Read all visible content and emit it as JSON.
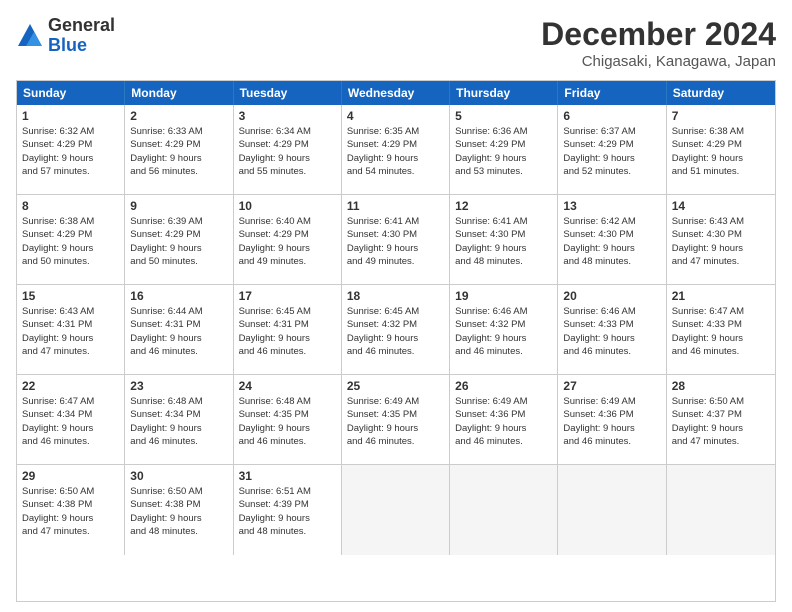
{
  "header": {
    "logo_general": "General",
    "logo_blue": "Blue",
    "month": "December 2024",
    "location": "Chigasaki, Kanagawa, Japan"
  },
  "weekdays": [
    "Sunday",
    "Monday",
    "Tuesday",
    "Wednesday",
    "Thursday",
    "Friday",
    "Saturday"
  ],
  "weeks": [
    [
      {
        "day": "1",
        "lines": [
          "Sunrise: 6:32 AM",
          "Sunset: 4:29 PM",
          "Daylight: 9 hours",
          "and 57 minutes."
        ]
      },
      {
        "day": "2",
        "lines": [
          "Sunrise: 6:33 AM",
          "Sunset: 4:29 PM",
          "Daylight: 9 hours",
          "and 56 minutes."
        ]
      },
      {
        "day": "3",
        "lines": [
          "Sunrise: 6:34 AM",
          "Sunset: 4:29 PM",
          "Daylight: 9 hours",
          "and 55 minutes."
        ]
      },
      {
        "day": "4",
        "lines": [
          "Sunrise: 6:35 AM",
          "Sunset: 4:29 PM",
          "Daylight: 9 hours",
          "and 54 minutes."
        ]
      },
      {
        "day": "5",
        "lines": [
          "Sunrise: 6:36 AM",
          "Sunset: 4:29 PM",
          "Daylight: 9 hours",
          "and 53 minutes."
        ]
      },
      {
        "day": "6",
        "lines": [
          "Sunrise: 6:37 AM",
          "Sunset: 4:29 PM",
          "Daylight: 9 hours",
          "and 52 minutes."
        ]
      },
      {
        "day": "7",
        "lines": [
          "Sunrise: 6:38 AM",
          "Sunset: 4:29 PM",
          "Daylight: 9 hours",
          "and 51 minutes."
        ]
      }
    ],
    [
      {
        "day": "8",
        "lines": [
          "Sunrise: 6:38 AM",
          "Sunset: 4:29 PM",
          "Daylight: 9 hours",
          "and 50 minutes."
        ]
      },
      {
        "day": "9",
        "lines": [
          "Sunrise: 6:39 AM",
          "Sunset: 4:29 PM",
          "Daylight: 9 hours",
          "and 50 minutes."
        ]
      },
      {
        "day": "10",
        "lines": [
          "Sunrise: 6:40 AM",
          "Sunset: 4:29 PM",
          "Daylight: 9 hours",
          "and 49 minutes."
        ]
      },
      {
        "day": "11",
        "lines": [
          "Sunrise: 6:41 AM",
          "Sunset: 4:30 PM",
          "Daylight: 9 hours",
          "and 49 minutes."
        ]
      },
      {
        "day": "12",
        "lines": [
          "Sunrise: 6:41 AM",
          "Sunset: 4:30 PM",
          "Daylight: 9 hours",
          "and 48 minutes."
        ]
      },
      {
        "day": "13",
        "lines": [
          "Sunrise: 6:42 AM",
          "Sunset: 4:30 PM",
          "Daylight: 9 hours",
          "and 48 minutes."
        ]
      },
      {
        "day": "14",
        "lines": [
          "Sunrise: 6:43 AM",
          "Sunset: 4:30 PM",
          "Daylight: 9 hours",
          "and 47 minutes."
        ]
      }
    ],
    [
      {
        "day": "15",
        "lines": [
          "Sunrise: 6:43 AM",
          "Sunset: 4:31 PM",
          "Daylight: 9 hours",
          "and 47 minutes."
        ]
      },
      {
        "day": "16",
        "lines": [
          "Sunrise: 6:44 AM",
          "Sunset: 4:31 PM",
          "Daylight: 9 hours",
          "and 46 minutes."
        ]
      },
      {
        "day": "17",
        "lines": [
          "Sunrise: 6:45 AM",
          "Sunset: 4:31 PM",
          "Daylight: 9 hours",
          "and 46 minutes."
        ]
      },
      {
        "day": "18",
        "lines": [
          "Sunrise: 6:45 AM",
          "Sunset: 4:32 PM",
          "Daylight: 9 hours",
          "and 46 minutes."
        ]
      },
      {
        "day": "19",
        "lines": [
          "Sunrise: 6:46 AM",
          "Sunset: 4:32 PM",
          "Daylight: 9 hours",
          "and 46 minutes."
        ]
      },
      {
        "day": "20",
        "lines": [
          "Sunrise: 6:46 AM",
          "Sunset: 4:33 PM",
          "Daylight: 9 hours",
          "and 46 minutes."
        ]
      },
      {
        "day": "21",
        "lines": [
          "Sunrise: 6:47 AM",
          "Sunset: 4:33 PM",
          "Daylight: 9 hours",
          "and 46 minutes."
        ]
      }
    ],
    [
      {
        "day": "22",
        "lines": [
          "Sunrise: 6:47 AM",
          "Sunset: 4:34 PM",
          "Daylight: 9 hours",
          "and 46 minutes."
        ]
      },
      {
        "day": "23",
        "lines": [
          "Sunrise: 6:48 AM",
          "Sunset: 4:34 PM",
          "Daylight: 9 hours",
          "and 46 minutes."
        ]
      },
      {
        "day": "24",
        "lines": [
          "Sunrise: 6:48 AM",
          "Sunset: 4:35 PM",
          "Daylight: 9 hours",
          "and 46 minutes."
        ]
      },
      {
        "day": "25",
        "lines": [
          "Sunrise: 6:49 AM",
          "Sunset: 4:35 PM",
          "Daylight: 9 hours",
          "and 46 minutes."
        ]
      },
      {
        "day": "26",
        "lines": [
          "Sunrise: 6:49 AM",
          "Sunset: 4:36 PM",
          "Daylight: 9 hours",
          "and 46 minutes."
        ]
      },
      {
        "day": "27",
        "lines": [
          "Sunrise: 6:49 AM",
          "Sunset: 4:36 PM",
          "Daylight: 9 hours",
          "and 46 minutes."
        ]
      },
      {
        "day": "28",
        "lines": [
          "Sunrise: 6:50 AM",
          "Sunset: 4:37 PM",
          "Daylight: 9 hours",
          "and 47 minutes."
        ]
      }
    ],
    [
      {
        "day": "29",
        "lines": [
          "Sunrise: 6:50 AM",
          "Sunset: 4:38 PM",
          "Daylight: 9 hours",
          "and 47 minutes."
        ]
      },
      {
        "day": "30",
        "lines": [
          "Sunrise: 6:50 AM",
          "Sunset: 4:38 PM",
          "Daylight: 9 hours",
          "and 48 minutes."
        ]
      },
      {
        "day": "31",
        "lines": [
          "Sunrise: 6:51 AM",
          "Sunset: 4:39 PM",
          "Daylight: 9 hours",
          "and 48 minutes."
        ]
      },
      {
        "day": "",
        "lines": []
      },
      {
        "day": "",
        "lines": []
      },
      {
        "day": "",
        "lines": []
      },
      {
        "day": "",
        "lines": []
      }
    ]
  ]
}
